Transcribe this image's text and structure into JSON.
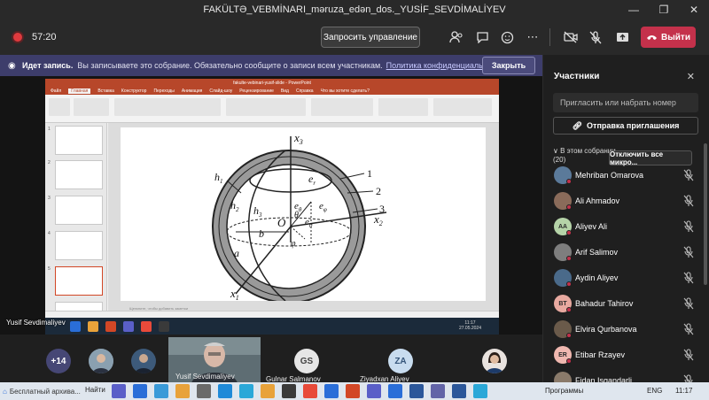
{
  "window": {
    "title": "FAKÜLTƏ_VEBMİNARI_məruza_edən_dos._YUSİF_SEVDİMALİYEV",
    "controls": [
      "minimize-icon",
      "maximize-icon",
      "close-icon"
    ]
  },
  "toolbar": {
    "timer": "57:20",
    "share_label": "Запросить управление",
    "leave_label": "Выйти",
    "icons": [
      "participants-icon",
      "chat-icon",
      "reactions-icon",
      "more-icon",
      "camera-off-icon",
      "mic-off-icon",
      "share-icon"
    ]
  },
  "banner": {
    "title": "Идет запись.",
    "text": "Вы записываете это собрание. Обязательно сообщите о записи всем участникам.",
    "link": "Политика конфиденциальности",
    "close_label": "Закрыть"
  },
  "shared_screen": {
    "app_title": "fakulte-vebinari-yusif-slide - PowerPoint",
    "tabs": [
      "Файл",
      "Главная",
      "Вставка",
      "Конструктор",
      "Переходы",
      "Анимация",
      "Слайд-шоу",
      "Рецензирование",
      "Вид",
      "Справка",
      "Что вы хотите сделать?"
    ],
    "active_tab": "Главная",
    "notes_placeholder": "Щелкните, чтобы добавить заметки",
    "clock_time": "11:17",
    "clock_date": "27.05.2024",
    "presenter": "Yusif Sevdimaliyev",
    "diagram_labels": {
      "x3": "x",
      "x3_sub": "3",
      "x2": "x",
      "x2_sub": "2",
      "x1": "x",
      "x1_sub": "1",
      "h1": "h",
      "h1_sub": "1",
      "h2": "h",
      "h2_sub": "2",
      "h3": "h",
      "h3_sub": "3",
      "er": "e",
      "er_sub": "r",
      "e_theta": "e",
      "e_theta_sub": "θ",
      "e_phi": "e",
      "e_phi_sub": "φ",
      "e0": "e",
      "e0_sub": "0",
      "O": "O",
      "theta": "θ",
      "phi": "φ",
      "a": "a",
      "b": "b",
      "n1": "1",
      "n2": "2",
      "n3": "3"
    }
  },
  "strip": {
    "overflow_count": "+14",
    "active_tile_name": "Yusif Sevdimaliyev",
    "tiles": [
      {
        "initials": "GS",
        "name": "Gulnar Salmanov"
      },
      {
        "initials": "ZA",
        "name": "Ziyadxan Aliyev"
      }
    ]
  },
  "panel": {
    "title": "Участники",
    "invite_placeholder": "Пригласить или набрать номер",
    "send_invite": "Отправка приглашения",
    "section_title": "В этом собрании",
    "section_count": "(20)",
    "mute_all": "Отключить все микро...",
    "participants": [
      {
        "name": "Mehriban Omarova",
        "initials": "",
        "color": "#5b7a9a"
      },
      {
        "name": "Ali Ahmadov",
        "initials": "",
        "color": "#8a6b5a"
      },
      {
        "name": "Aliyev Ali",
        "initials": "AA",
        "color": "#b5d3a8"
      },
      {
        "name": "Arif Salimov",
        "initials": "",
        "color": "#7e7e7e"
      },
      {
        "name": "Aydin Aliyev",
        "initials": "",
        "color": "#4a6a8a"
      },
      {
        "name": "Bahadur Tahirov",
        "initials": "BT",
        "color": "#e8a9a0"
      },
      {
        "name": "Elvira Qurbanova",
        "initials": "",
        "color": "#6a5a4a"
      },
      {
        "name": "Etibar Rzayev",
        "initials": "ER",
        "color": "#f0b8b0"
      },
      {
        "name": "Fidan Isgandarli",
        "initials": "",
        "color": "#8a7a6a"
      }
    ]
  },
  "taskbar": {
    "news": "Бесплатный архива...",
    "find": "Найти",
    "programs": "Программы",
    "lang": "ENG",
    "clock": "11:17"
  }
}
